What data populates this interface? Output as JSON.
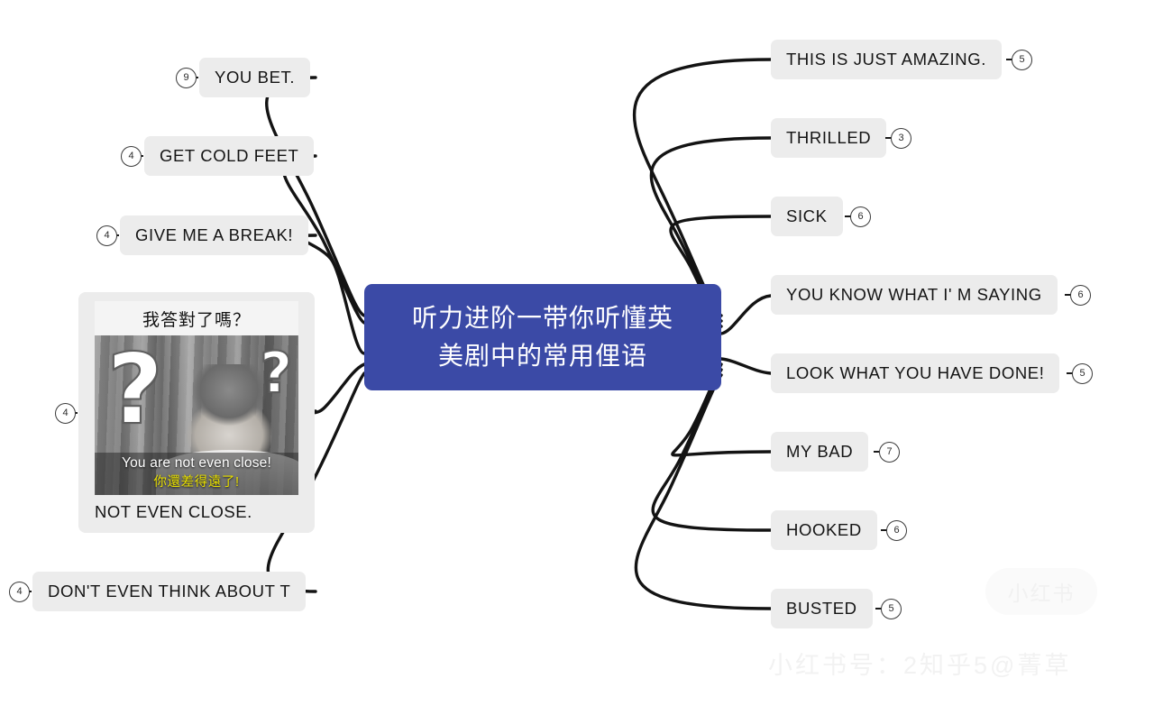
{
  "central": {
    "title": "听力进阶一带你听懂英\n美剧中的常用俚语",
    "color": "#3b4aa6"
  },
  "right_branches": [
    {
      "label": "THIS IS JUST AMAZING.",
      "badge": "5"
    },
    {
      "label": "THRILLED",
      "badge": "3"
    },
    {
      "label": "SICK",
      "badge": "6"
    },
    {
      "label": "YOU KNOW WHAT I' M SAYING",
      "badge": "6"
    },
    {
      "label": "LOOK WHAT YOU HAVE DONE!",
      "badge": "5"
    },
    {
      "label": "MY BAD",
      "badge": "7"
    },
    {
      "label": "HOOKED",
      "badge": "6"
    },
    {
      "label": "BUSTED",
      "badge": "5"
    }
  ],
  "left_branches": [
    {
      "label": "YOU BET.",
      "badge": "9"
    },
    {
      "label": "GET COLD FEET",
      "badge": "4"
    },
    {
      "label": "GIVE ME A BREAK!",
      "badge": "4"
    },
    {
      "label": "DON'T EVEN THINK ABOUT T",
      "badge": "4"
    }
  ],
  "image_card": {
    "badge": "4",
    "header_text": "我答對了嗎？",
    "caption_en": "You are not even close!",
    "caption_zh": "你還差得遠了!",
    "label": "NOT EVEN CLOSE.",
    "caption_zh_color": "#e9e000"
  },
  "watermarks": {
    "handle_text": "小红书号：2知乎5@菁草",
    "logo_text": "小红书"
  },
  "theme": {
    "pill_bg": "#ececec",
    "edge_color": "#131313",
    "text_color": "#141414",
    "page_bg": "#ffffff"
  }
}
